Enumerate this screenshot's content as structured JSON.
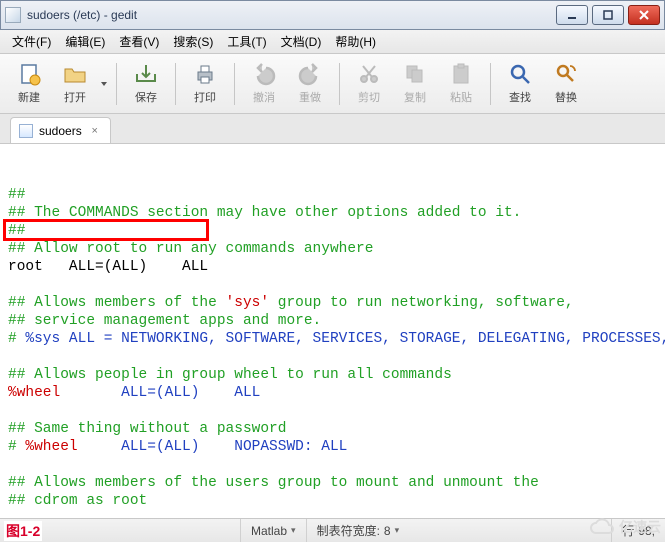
{
  "window": {
    "title": "sudoers (/etc) - gedit"
  },
  "menu": [
    "文件(F)",
    "编辑(E)",
    "查看(V)",
    "搜索(S)",
    "工具(T)",
    "文档(D)",
    "帮助(H)"
  ],
  "toolbar": {
    "new": "新建",
    "open": "打开",
    "save": "保存",
    "print": "打印",
    "undo": "撤消",
    "redo": "重做",
    "cut": "剪切",
    "copy": "复制",
    "paste": "粘贴",
    "find": "查找",
    "replace": "替换"
  },
  "tab": {
    "name": "sudoers"
  },
  "editor": {
    "l1": "##",
    "l2": "## The COMMANDS section may have other options added to it.",
    "l3": "##",
    "l4": "## Allow root to run any commands anywhere",
    "l5": "root   ALL=(ALL)    ALL",
    "l7a": "## Allows members of the ",
    "l7b": "'sys'",
    "l7c": " group to run networking, software,",
    "l8": "## service management apps and more.",
    "l9a": "# ",
    "l9b": "%sys ALL = NETWORKING, SOFTWARE, SERVICES, STORAGE, DELEGATING, PROCESSES, LOCATE, DRIVERS",
    "l11": "## Allows people in group wheel to run all commands",
    "l12a": "%wheel",
    "l12b": "       ALL=(ALL)    ALL",
    "l14": "## Same thing without a password",
    "l15a": "# ",
    "l15b": "%wheel",
    "l15c": "     ALL=(ALL)    NOPASSWD: ALL",
    "l17": "## Allows members of the users group to mount and unmount the",
    "l18": "## cdrom as root"
  },
  "status": {
    "syntax": "Matlab",
    "tabwidth_label": "制表符宽度:",
    "tabwidth_value": "8",
    "line_label": "行",
    "line_value": "98,"
  },
  "figure_label": "图1-2",
  "watermark": "亿速云"
}
